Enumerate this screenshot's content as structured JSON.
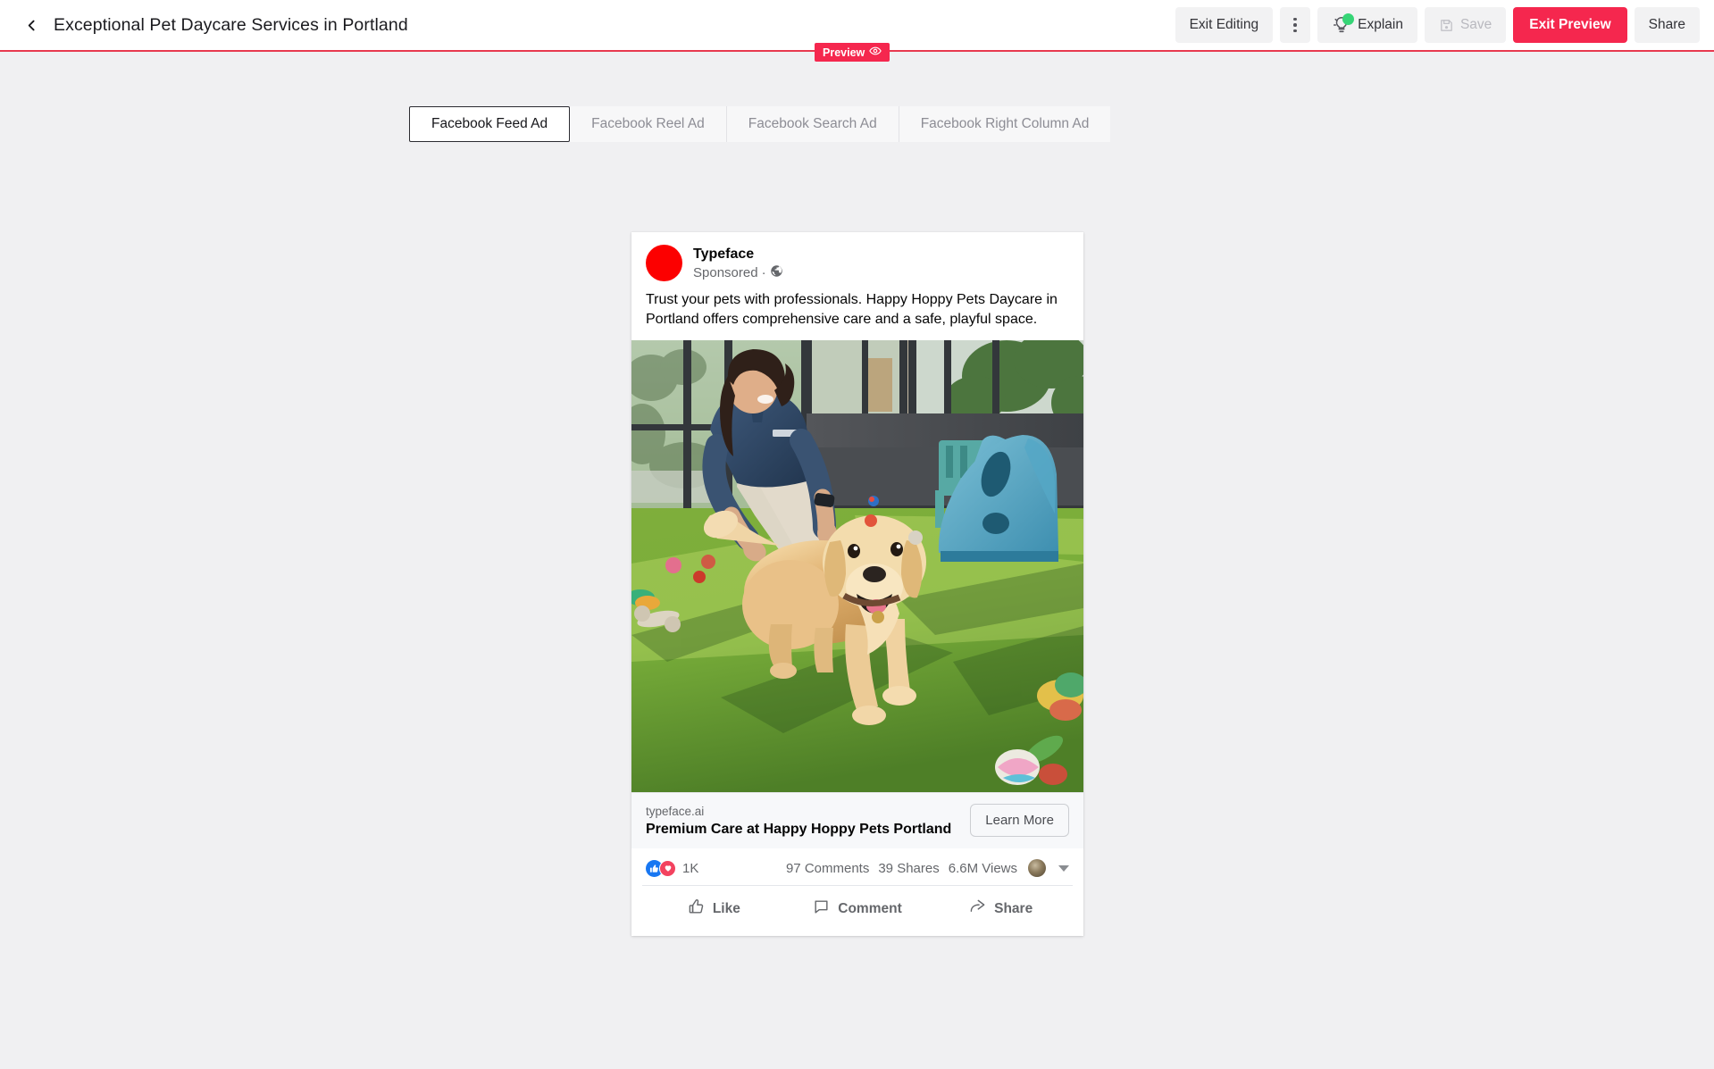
{
  "header": {
    "back_icon": "chevron-left-icon",
    "title": "Exceptional Pet Daycare Services in Portland",
    "buttons": {
      "exit_editing": "Exit Editing",
      "more": "",
      "explain": "Explain",
      "save": "Save",
      "exit_preview": "Exit Preview",
      "share": "Share"
    },
    "icons": {
      "explain": "lightbulb-icon",
      "save": "floppy-disk-icon",
      "more": "kebab-menu-icon"
    },
    "accent_color": "#f5274e",
    "explain_badge_color": "#36d576"
  },
  "preview_badge": {
    "label": "Preview",
    "icon": "eye-icon",
    "color": "#f5274e"
  },
  "tabs": [
    {
      "label": "Facebook Feed Ad",
      "active": true
    },
    {
      "label": "Facebook Reel Ad",
      "active": false
    },
    {
      "label": "Facebook Search Ad",
      "active": false
    },
    {
      "label": "Facebook Right Column Ad",
      "active": false
    }
  ],
  "ad": {
    "brand": "Typeface",
    "sponsored_label": "Sponsored",
    "separator": "·",
    "audience_icon": "globe-icon",
    "avatar_color": "#fc0000",
    "body_text": "Trust your pets with professionals. Happy Hoppy Pets Daycare in Portland offers comprehensive care and a safe, playful space.",
    "image_alt": "Dog daycare attendant in navy polo petting a golden retriever on artificial turf with blue slide and toys",
    "link": {
      "domain": "typeface.ai",
      "headline": "Premium Care at Happy Hoppy Pets Portland",
      "cta": "Learn More"
    },
    "stats": {
      "reactions": [
        "like-reaction-icon",
        "love-reaction-icon"
      ],
      "reaction_count": "1K",
      "comments": "97 Comments",
      "shares": "39 Shares",
      "views": "6.6M Views",
      "viewer_avatar": "viewer-avatar",
      "dropdown_icon": "caret-down-icon"
    },
    "actions": [
      {
        "label": "Like",
        "icon": "thumbs-up-icon"
      },
      {
        "label": "Comment",
        "icon": "speech-bubble-icon"
      },
      {
        "label": "Share",
        "icon": "share-arrow-icon"
      }
    ]
  }
}
